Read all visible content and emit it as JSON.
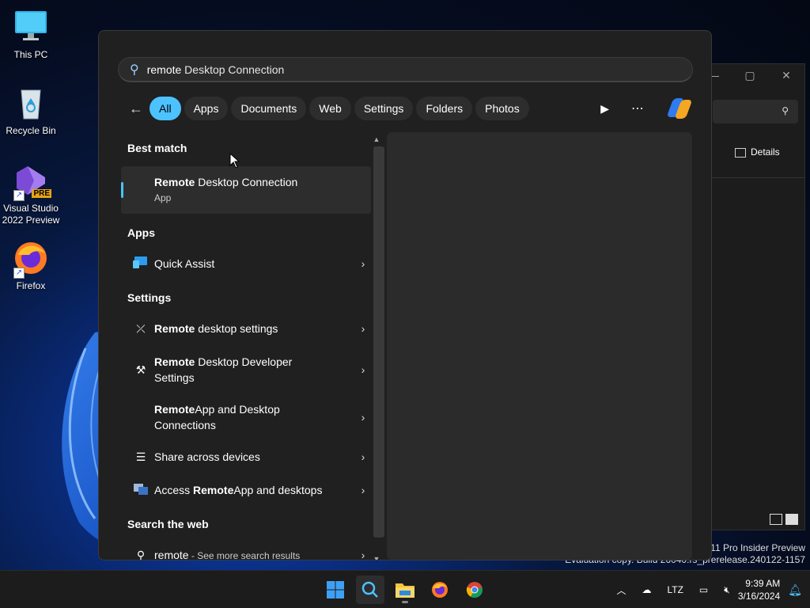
{
  "desktop": {
    "icons": [
      {
        "label": "This PC"
      },
      {
        "label": "Recycle Bin"
      },
      {
        "label": "Visual Studio\n2022 Preview",
        "badge": "PRE"
      },
      {
        "label": "Firefox"
      }
    ]
  },
  "explorer": {
    "details_label": "Details",
    "title_buttons": [
      "—",
      "▢",
      "✕"
    ]
  },
  "watermark": {
    "line1": "s 11 Pro Insider Preview",
    "line2": "Evaluation copy. Build 26040.rs_prerelease.240122-1157"
  },
  "search": {
    "query_bold": "remote",
    "query_rest": " Desktop Connection",
    "filters": [
      "All",
      "Apps",
      "Documents",
      "Web",
      "Settings",
      "Folders",
      "Photos"
    ],
    "active_filter": "All"
  },
  "results": {
    "best_match_header": "Best match",
    "best": {
      "bold": "Remote",
      "rest": " Desktop Connection",
      "sub": "App"
    },
    "apps_header": "Apps",
    "apps": [
      {
        "label": "Quick Assist",
        "icon": "quick-assist-icon"
      }
    ],
    "settings_header": "Settings",
    "settings": [
      {
        "bold": "Remote",
        "rest": " desktop settings",
        "icon": "remote-desktop-settings-icon"
      },
      {
        "bold": "Remote",
        "rest": " Desktop Developer",
        "rest2": "Settings",
        "icon": "developer-settings-icon"
      },
      {
        "bold": "Remote",
        "rest": "App and Desktop",
        "rest2": "Connections",
        "icon": "remoteapp-icon"
      },
      {
        "bold": "",
        "rest": "Share across devices",
        "icon": "share-devices-icon"
      },
      {
        "pre": "Access ",
        "bold": "Remote",
        "rest": "App and desktops",
        "icon": "access-remoteapp-icon"
      }
    ],
    "web_header": "Search the web",
    "web": {
      "query": "remote",
      "suffix": " - See more search results"
    }
  },
  "taskbar": {
    "time": "9:39 AM",
    "date": "3/16/2024",
    "lang": "LTZ"
  },
  "colors": {
    "accent": "#4cc2ff",
    "flyout_bg": "#202020",
    "taskbar_bg": "#1c1c1c"
  }
}
